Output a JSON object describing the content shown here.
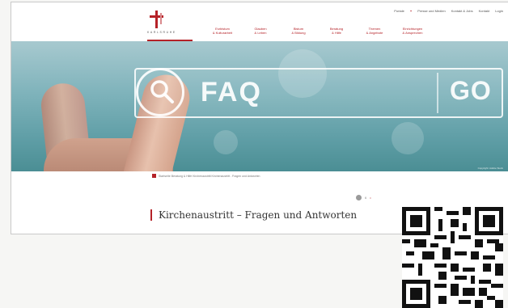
{
  "header": {
    "logo_text": "KARLSRUHE",
    "top_links": [
      "Portale",
      "Presse und Medien",
      "Kontakt & Jobs",
      "Kontakt",
      "Login"
    ],
    "nav": [
      {
        "line1": "Erzbistum",
        "line2": "& Kulturarbeit"
      },
      {
        "line1": "Glauben",
        "line2": "& Leben"
      },
      {
        "line1": "Bistum",
        "line2": "& Bildung"
      },
      {
        "line1": "Beratung",
        "line2": "& Hilfe"
      },
      {
        "line1": "Themen",
        "line2": "& Angebote"
      },
      {
        "line1": "Einrichtungen",
        "line2": "& Ansprechen"
      }
    ]
  },
  "hero": {
    "search_label": "FAQ",
    "go_label": "GO",
    "credit": "Copyright: Adobe Stock"
  },
  "breadcrumb": "Startseite Beratung & Hilfe  Kirchenaustritt  Kirchenaustritt - Fragen und Antworten",
  "share": {
    "count": "6",
    "dot": "•"
  },
  "page_title": "Kirchenaustritt – Fragen und Antworten",
  "colors": {
    "accent": "#b52228"
  },
  "icons": [
    "search-icon",
    "home-icon",
    "share-icon",
    "qr-code"
  ]
}
